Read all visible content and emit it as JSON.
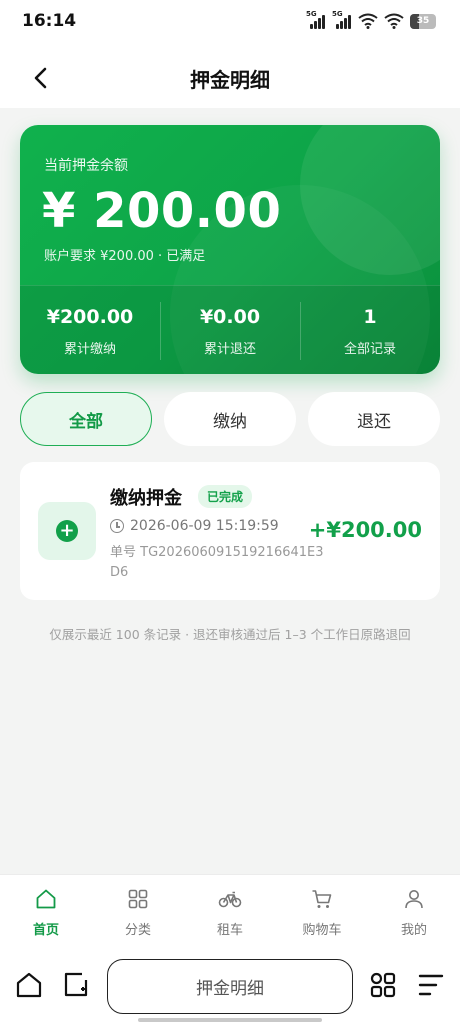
{
  "status_bar": {
    "time": "16:14",
    "network_1": "5G",
    "network_2": "5G",
    "battery": "35",
    "icons": [
      "signal-icon",
      "signal-icon",
      "wifi-icon",
      "wifi-icon",
      "battery-icon"
    ]
  },
  "nav": {
    "title": "押金明细",
    "back_icon": "back-arrow-icon"
  },
  "balance_card": {
    "label": "当前押金余额",
    "amount": "¥ 200.00",
    "requirement": "账户要求 ¥200.00 · 已满足",
    "stats": [
      {
        "value": "¥200.00",
        "label": "累计缴纳"
      },
      {
        "value": "¥0.00",
        "label": "累计退还"
      },
      {
        "value": "1",
        "label": "全部记录"
      }
    ]
  },
  "filters": [
    {
      "label": "全部",
      "active": true
    },
    {
      "label": "缴纳",
      "active": false
    },
    {
      "label": "退还",
      "active": false
    }
  ],
  "records": [
    {
      "title": "缴纳押金",
      "status": "已完成",
      "time": "2026-06-09 15:19:59",
      "order_no": "单号 TG202606091519216641E3D6",
      "amount": "+¥200.00",
      "icon": "plus-circle-icon"
    }
  ],
  "footnote": "仅展示最近 100 条记录 · 退还审核通过后 1–3 个工作日原路退回",
  "tabbar": [
    {
      "label": "首页",
      "icon": "home-icon",
      "active": true
    },
    {
      "label": "分类",
      "icon": "grid-icon",
      "active": false
    },
    {
      "label": "租车",
      "icon": "bicycle-icon",
      "active": false
    },
    {
      "label": "购物车",
      "icon": "cart-icon",
      "active": false
    },
    {
      "label": "我的",
      "icon": "user-icon",
      "active": false
    }
  ],
  "browser_bar": {
    "url_title": "押金明细",
    "icons": [
      "browser-home-icon",
      "browser-tabs-icon",
      "apps-icon",
      "menu-icon"
    ]
  },
  "colors": {
    "accent": "#12a04a",
    "card_gradient_start": "#10b14d",
    "card_gradient_end": "#0a8e3c",
    "background": "#f3f4f3"
  }
}
